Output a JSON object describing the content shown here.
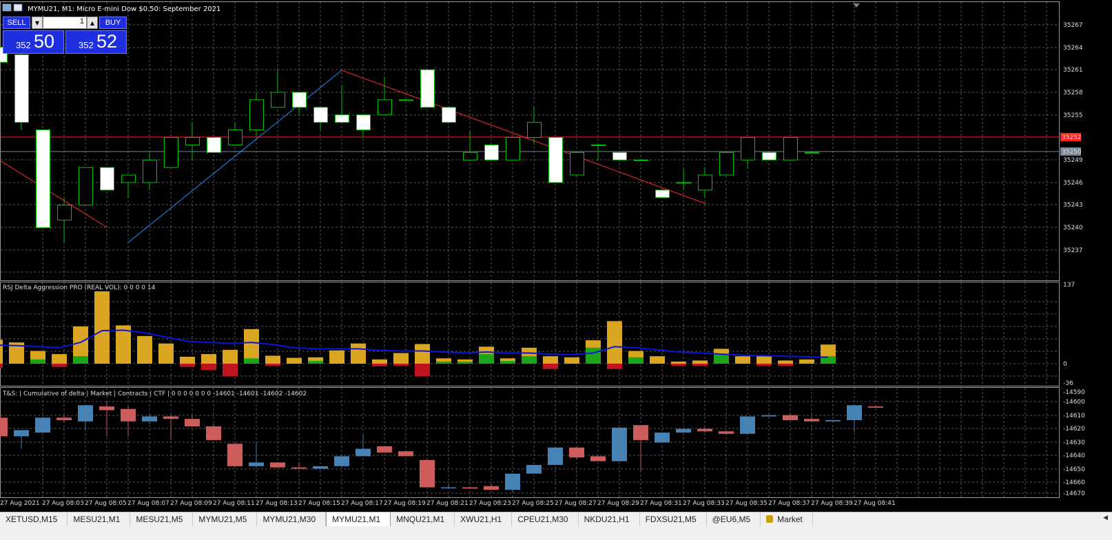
{
  "window": {
    "title": "MYMU21, M1:  Micro E-mini Dow $0.50: September 2021"
  },
  "trade_panel": {
    "sell_label": "SELL",
    "buy_label": "BUY",
    "lot_value": "1",
    "sell_price_small": "352",
    "sell_price_big": "50",
    "buy_price_small": "352",
    "buy_price_big": "52"
  },
  "price_axis": {
    "labels": [
      "35267",
      "35264",
      "35261",
      "35258",
      "35255",
      "35252",
      "35250",
      "35249",
      "35246",
      "35243",
      "35240",
      "35237"
    ],
    "bid_label": "35252",
    "ask_label": "35250"
  },
  "indicator1": {
    "title": "RSJ Delta Aggression PRO (REAL VOL): 0 0 0 0 14",
    "axis_labels": [
      "137",
      "0",
      "-36"
    ]
  },
  "indicator2": {
    "title": "T&S: | Cumulative of delta | Market | Contracts | CTF | 0 0 0 0 0 0 0 -14601 -14601 -14602 -14602",
    "axis_labels": [
      "-14590",
      "-14600",
      "-14610",
      "-14620",
      "-14630",
      "-14640",
      "-14650",
      "-14660",
      "-14670"
    ]
  },
  "time_axis": {
    "labels": [
      "27 Aug 2021",
      "27 Aug 08:03",
      "27 Aug 08:05",
      "27 Aug 08:07",
      "27 Aug 08:09",
      "27 Aug 08:11",
      "27 Aug 08:13",
      "27 Aug 08:15",
      "27 Aug 08:17",
      "27 Aug 08:19",
      "27 Aug 08:21",
      "27 Aug 08:23",
      "27 Aug 08:25",
      "27 Aug 08:27",
      "27 Aug 08:29",
      "27 Aug 08:31",
      "27 Aug 08:33",
      "27 Aug 08:35",
      "27 Aug 08:37",
      "27 Aug 08:39",
      "27 Aug 08:41"
    ]
  },
  "tabs": [
    {
      "label": "XETUSD,M15"
    },
    {
      "label": "MESU21,M1"
    },
    {
      "label": "MESU21,M5"
    },
    {
      "label": "MYMU21,M5"
    },
    {
      "label": "MYMU21,M30"
    },
    {
      "label": "MYMU21,M1",
      "active": true
    },
    {
      "label": "MNQU21,M1"
    },
    {
      "label": "XWU21,H1"
    },
    {
      "label": "CPEU21,M30"
    },
    {
      "label": "NKDU21,H1"
    },
    {
      "label": "FDXSU21,M5"
    },
    {
      "label": "@EU6,M5"
    },
    {
      "label": "Market",
      "icon": "lock-icon"
    }
  ],
  "colors": {
    "background": "#000000",
    "bull_body": "#000000",
    "bull_border": "#00c800",
    "bear_body": "#ffffff",
    "bid_line": "#ff2020",
    "ask_line": "#778899",
    "delta_bar": "#daa520",
    "delta_pos": "#1aa51a",
    "delta_neg": "#c0141e",
    "delta_ma": "#0a14dc",
    "cd_up": "#4682b4",
    "cd_down": "#cd5c5c"
  },
  "chart_data": {
    "type": "candlestick",
    "symbol": "MYMU21",
    "timeframe": "M1",
    "candles": [
      {
        "o": 35264,
        "h": 35264,
        "l": 35262,
        "c": 35262
      },
      {
        "o": 35263,
        "h": 35266,
        "l": 35253,
        "c": 35254
      },
      {
        "o": 35253,
        "h": 35253,
        "l": 35240,
        "c": 35240
      },
      {
        "o": 35241,
        "h": 35244,
        "l": 35238,
        "c": 35243
      },
      {
        "o": 35243,
        "h": 35248,
        "l": 35243,
        "c": 35248
      },
      {
        "o": 35248,
        "h": 35248,
        "l": 35245,
        "c": 35245
      },
      {
        "o": 35246,
        "h": 35247,
        "l": 35244,
        "c": 35247
      },
      {
        "o": 35246,
        "h": 35250,
        "l": 35245,
        "c": 35249
      },
      {
        "o": 35248,
        "h": 35252,
        "l": 35248,
        "c": 35252
      },
      {
        "o": 35251,
        "h": 35254,
        "l": 35249,
        "c": 35252
      },
      {
        "o": 35252,
        "h": 35252,
        "l": 35250,
        "c": 35250
      },
      {
        "o": 35251,
        "h": 35254,
        "l": 35251,
        "c": 35253
      },
      {
        "o": 35253,
        "h": 35258,
        "l": 35252,
        "c": 35257
      },
      {
        "o": 35256,
        "h": 35261,
        "l": 35256,
        "c": 35258
      },
      {
        "o": 35258,
        "h": 35258,
        "l": 35255,
        "c": 35256
      },
      {
        "o": 35256,
        "h": 35256,
        "l": 35253,
        "c": 35254
      },
      {
        "o": 35255,
        "h": 35259,
        "l": 35254,
        "c": 35254
      },
      {
        "o": 35255,
        "h": 35255,
        "l": 35252,
        "c": 35253
      },
      {
        "o": 35255,
        "h": 35260,
        "l": 35255,
        "c": 35257
      },
      {
        "o": 35257,
        "h": 35257,
        "l": 35257,
        "c": 35257
      },
      {
        "o": 35261,
        "h": 35261,
        "l": 35256,
        "c": 35256
      },
      {
        "o": 35256,
        "h": 35256,
        "l": 35254,
        "c": 35254
      },
      {
        "o": 35249,
        "h": 35253,
        "l": 35249,
        "c": 35250
      },
      {
        "o": 35251,
        "h": 35251,
        "l": 35249,
        "c": 35249
      },
      {
        "o": 35249,
        "h": 35252,
        "l": 35249,
        "c": 35252
      },
      {
        "o": 35252,
        "h": 35256,
        "l": 35251,
        "c": 35254
      },
      {
        "o": 35252,
        "h": 35252,
        "l": 35246,
        "c": 35246
      },
      {
        "o": 35247,
        "h": 35250,
        "l": 35247,
        "c": 35250
      },
      {
        "o": 35251,
        "h": 35251,
        "l": 35249,
        "c": 35251
      },
      {
        "o": 35250,
        "h": 35250,
        "l": 35249,
        "c": 35249
      },
      {
        "o": 35249,
        "h": 35249,
        "l": 35249,
        "c": 35249
      },
      {
        "o": 35245,
        "h": 35245,
        "l": 35244,
        "c": 35244
      },
      {
        "o": 35246,
        "h": 35248,
        "l": 35245,
        "c": 35246
      },
      {
        "o": 35245,
        "h": 35248,
        "l": 35244,
        "c": 35247
      },
      {
        "o": 35247,
        "h": 35250,
        "l": 35247,
        "c": 35250
      },
      {
        "o": 35249,
        "h": 35252,
        "l": 35248,
        "c": 35252
      },
      {
        "o": 35250,
        "h": 35250,
        "l": 35249,
        "c": 35249
      },
      {
        "o": 35249,
        "h": 35252,
        "l": 35249,
        "c": 35252
      },
      {
        "o": 35250,
        "h": 35250,
        "l": 35250,
        "c": 35250
      }
    ],
    "delta_bars": [
      {
        "v": 45,
        "d": -8
      },
      {
        "v": 40,
        "d": 0
      },
      {
        "v": 24,
        "d": 8
      },
      {
        "v": 18,
        "d": -6
      },
      {
        "v": 70,
        "d": 14
      },
      {
        "v": 136,
        "d": 0
      },
      {
        "v": 72,
        "d": 0
      },
      {
        "v": 52,
        "d": 0
      },
      {
        "v": 38,
        "d": 0
      },
      {
        "v": 13,
        "d": -6
      },
      {
        "v": 18,
        "d": -12
      },
      {
        "v": 26,
        "d": -24
      },
      {
        "v": 65,
        "d": 10
      },
      {
        "v": 15,
        "d": -4
      },
      {
        "v": 11,
        "d": 0
      },
      {
        "v": 12,
        "d": 5
      },
      {
        "v": 25,
        "d": 0
      },
      {
        "v": 38,
        "d": 0
      },
      {
        "v": 8,
        "d": -5
      },
      {
        "v": 20,
        "d": -4
      },
      {
        "v": 37,
        "d": -24
      },
      {
        "v": 10,
        "d": 4
      },
      {
        "v": 8,
        "d": 4
      },
      {
        "v": 32,
        "d": 18
      },
      {
        "v": 10,
        "d": 5
      },
      {
        "v": 30,
        "d": 14
      },
      {
        "v": 14,
        "d": -10
      },
      {
        "v": 12,
        "d": 0
      },
      {
        "v": 44,
        "d": 30
      },
      {
        "v": 80,
        "d": -10
      },
      {
        "v": 24,
        "d": 12
      },
      {
        "v": 14,
        "d": 0
      },
      {
        "v": 4,
        "d": -4
      },
      {
        "v": 6,
        "d": -4
      },
      {
        "v": 28,
        "d": 18
      },
      {
        "v": 14,
        "d": 0
      },
      {
        "v": 14,
        "d": -4
      },
      {
        "v": 6,
        "d": -4
      },
      {
        "v": 8,
        "d": 0
      },
      {
        "v": 36,
        "d": 14
      }
    ],
    "delta_ma": [
      35,
      34,
      32,
      30,
      40,
      62,
      63,
      58,
      50,
      42,
      40,
      38,
      40,
      36,
      30,
      28,
      28,
      28,
      25,
      24,
      24,
      22,
      20,
      22,
      20,
      20,
      18,
      17,
      20,
      32,
      30,
      26,
      22,
      20,
      18,
      16,
      15,
      14,
      13,
      12
    ],
    "cumdelta_ylim": [
      -14674,
      -14586
    ],
    "cumdelta": [
      {
        "o": -14610,
        "h": -14608,
        "l": -14625,
        "c": -14625
      },
      {
        "o": -14625,
        "h": -14620,
        "l": -14635,
        "c": -14620
      },
      {
        "o": -14622,
        "h": -14610,
        "l": -14622,
        "c": -14610
      },
      {
        "o": -14610,
        "h": -14608,
        "l": -14614,
        "c": -14612
      },
      {
        "o": -14613,
        "h": -14600,
        "l": -14620,
        "c": -14600
      },
      {
        "o": -14601,
        "h": -14597,
        "l": -14625,
        "c": -14604
      },
      {
        "o": -14603,
        "h": -14601,
        "l": -14625,
        "c": -14613
      },
      {
        "o": -14613,
        "h": -14607,
        "l": -14615,
        "c": -14609
      },
      {
        "o": -14609,
        "h": -14608,
        "l": -14628,
        "c": -14611
      },
      {
        "o": -14611,
        "h": -14608,
        "l": -14611,
        "c": -14617
      },
      {
        "o": -14617,
        "h": -14615,
        "l": -14628,
        "c": -14628
      },
      {
        "o": -14631,
        "h": -14631,
        "l": -14649,
        "c": -14649
      },
      {
        "o": -14649,
        "h": -14630,
        "l": -14649,
        "c": -14646
      },
      {
        "o": -14646,
        "h": -14646,
        "l": -14650,
        "c": -14650
      },
      {
        "o": -14650,
        "h": -14646,
        "l": -14651,
        "c": -14651
      },
      {
        "o": -14651,
        "h": -14649,
        "l": -14651,
        "c": -14649
      },
      {
        "o": -14649,
        "h": -14641,
        "l": -14649,
        "c": -14641
      },
      {
        "o": -14641,
        "h": -14624,
        "l": -14641,
        "c": -14635
      },
      {
        "o": -14633,
        "h": -14633,
        "l": -14638,
        "c": -14638
      },
      {
        "o": -14637,
        "h": -14637,
        "l": -14641,
        "c": -14641
      },
      {
        "o": -14644,
        "h": -14644,
        "l": -14666,
        "c": -14666
      },
      {
        "o": -14666,
        "h": -14664,
        "l": -14666,
        "c": -14666
      },
      {
        "o": -14666,
        "h": -14665,
        "l": -14667,
        "c": -14667
      },
      {
        "o": -14665,
        "h": -14663,
        "l": -14668,
        "c": -14668
      },
      {
        "o": -14668,
        "h": -14655,
        "l": -14670,
        "c": -14655
      },
      {
        "o": -14655,
        "h": -14648,
        "l": -14655,
        "c": -14648
      },
      {
        "o": -14648,
        "h": -14634,
        "l": -14648,
        "c": -14634
      },
      {
        "o": -14634,
        "h": -14634,
        "l": -14643,
        "c": -14642
      },
      {
        "o": -14641,
        "h": -14641,
        "l": -14645,
        "c": -14645
      },
      {
        "o": -14645,
        "h": -14618,
        "l": -14645,
        "c": -14618
      },
      {
        "o": -14616,
        "h": -14616,
        "l": -14653,
        "c": -14628
      },
      {
        "o": -14630,
        "h": -14622,
        "l": -14630,
        "c": -14622
      },
      {
        "o": -14622,
        "h": -14619,
        "l": -14622,
        "c": -14619
      },
      {
        "o": -14619,
        "h": -14618,
        "l": -14622,
        "c": -14621
      },
      {
        "o": -14621,
        "h": -14621,
        "l": -14623,
        "c": -14623
      },
      {
        "o": -14623,
        "h": -14609,
        "l": -14623,
        "c": -14609
      },
      {
        "o": -14609,
        "h": -14608,
        "l": -14609,
        "c": -14608
      },
      {
        "o": -14608,
        "h": -14607,
        "l": -14612,
        "c": -14612
      },
      {
        "o": -14611,
        "h": -14609,
        "l": -14613,
        "c": -14613
      },
      {
        "o": -14613,
        "h": -14612,
        "l": -14613,
        "c": -14612
      },
      {
        "o": -14612,
        "h": -14600,
        "l": -14622,
        "c": -14600
      },
      {
        "o": -14601,
        "h": -14600,
        "l": -14602,
        "c": -14602
      }
    ]
  }
}
